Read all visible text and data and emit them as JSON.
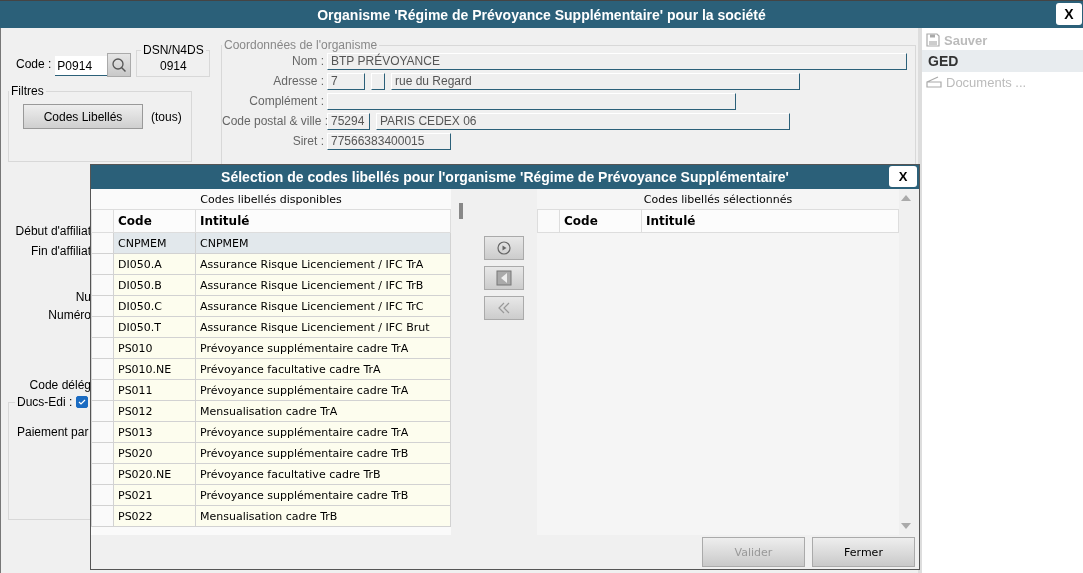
{
  "window": {
    "title": "Organisme 'Régime de Prévoyance Supplémentaire' pour la société",
    "close_label": "X"
  },
  "form": {
    "code": {
      "label": "Code :",
      "value": "P0914"
    },
    "dsn": {
      "legend": "DSN/N4DS",
      "value": "0914"
    },
    "filters": {
      "legend": "Filtres",
      "button": "Codes Libellés",
      "value": "(tous)"
    },
    "partial_labels": [
      "Début d'affiliat",
      "Fin d'affiliat",
      "Nu",
      "Numéro",
      "Code délég"
    ],
    "ducs_edi": {
      "label": "Ducs-Edi :",
      "checked": true
    },
    "payment_label": "Paiement par",
    "coordinates": {
      "legend": "Coordonnées de l'organisme",
      "fields": [
        {
          "label": "Nom :",
          "values": [
            {
              "value": "BTP PRÉVOYANCE",
              "disabled": true
            }
          ]
        },
        {
          "label": "Adresse :",
          "values": [
            {
              "value": "7",
              "disabled": true
            },
            {
              "disabled": true
            },
            {
              "value": "rue du Regard",
              "disabled": true
            }
          ]
        },
        {
          "label": "Complément :",
          "values": [
            {
              "disabled": true
            }
          ]
        },
        {
          "label": "Code postal & ville :",
          "values": [
            {
              "value": "75294",
              "disabled": true
            },
            {
              "value": "PARIS CEDEX 06",
              "disabled": true
            }
          ]
        },
        {
          "label": "Siret :",
          "values": [
            {
              "value": "77566383400015",
              "disabled": true
            }
          ]
        }
      ]
    }
  },
  "side": {
    "items": [
      {
        "kind": "save",
        "label": "Sauver",
        "disabled": true
      },
      {
        "kind": "header",
        "label": "GED",
        "disabled": false
      },
      {
        "kind": "scan",
        "label": "Documents ...",
        "disabled": true
      }
    ]
  },
  "dialog": {
    "title": "Sélection de codes libellés pour l'organisme 'Régime de Prévoyance Supplémentaire'",
    "close_label": "X",
    "available": {
      "caption": "Codes libellés disponibles",
      "columns": [
        "Code",
        "Intitulé"
      ],
      "rows": [
        {
          "code": "CNPMEM",
          "label": "CNPMEM",
          "selected": true
        },
        {
          "code": "DI050.A",
          "label": "Assurance Risque Licenciement / IFC TrA",
          "selected": false
        },
        {
          "code": "DI050.B",
          "label": "Assurance Risque Licenciement / IFC TrB",
          "selected": false
        },
        {
          "code": "DI050.C",
          "label": "Assurance Risque Licenciement / IFC TrC",
          "selected": false
        },
        {
          "code": "DI050.T",
          "label": "Assurance Risque Licenciement / IFC Brut",
          "selected": false
        },
        {
          "code": "PS010",
          "label": "Prévoyance supplémentaire cadre TrA",
          "selected": false
        },
        {
          "code": "PS010.NE",
          "label": "Prévoyance facultative cadre TrA",
          "selected": false
        },
        {
          "code": "PS011",
          "label": "Prévoyance supplémentaire cadre TrA",
          "selected": false
        },
        {
          "code": "PS012",
          "label": "Mensualisation cadre TrA",
          "selected": false
        },
        {
          "code": "PS013",
          "label": "Prévoyance supplémentaire cadre TrA",
          "selected": false
        },
        {
          "code": "PS020",
          "label": "Prévoyance supplémentaire cadre TrB",
          "selected": false
        },
        {
          "code": "PS020.NE",
          "label": "Prévoyance facultative cadre TrB",
          "selected": false
        },
        {
          "code": "PS021",
          "label": "Prévoyance supplémentaire cadre TrB",
          "selected": false
        },
        {
          "code": "PS022",
          "label": "Mensualisation cadre TrB",
          "selected": false
        }
      ]
    },
    "chosen": {
      "caption": "Codes libellés sélectionnés",
      "columns": [
        "Code",
        "Intitulé"
      ]
    },
    "buttons": [
      {
        "label": "Valider",
        "disabled": true
      },
      {
        "label": "Fermer",
        "disabled": false
      }
    ]
  }
}
